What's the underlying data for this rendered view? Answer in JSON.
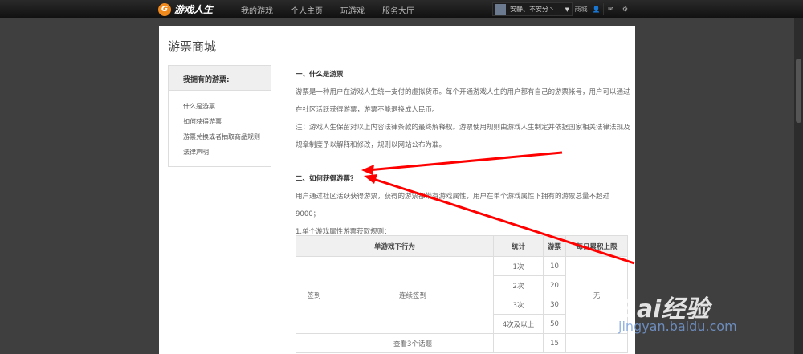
{
  "topbar": {
    "logo": "游戏人生",
    "nav": [
      "我的游戏",
      "个人主页",
      "玩游戏",
      "服务大厅"
    ],
    "username": "安静、不安分丶",
    "mall": "商城"
  },
  "page": {
    "title": "游票商城",
    "sidebar": {
      "header": "我拥有的游票:",
      "items": [
        "什么是游票",
        "如何获得游票",
        "游票兑换或者抽取商品规则",
        "法律声明"
      ]
    },
    "s1": {
      "heading": "一、什么是游票",
      "p1": "游票是一种用户在游戏人生统一支付的虚拟货币。每个开通游戏人生的用户都有自己的游票帐号，用户可以通过在社区活跃获得游票，游票不能退换成人民币。",
      "p2": "注：游戏人生保留对以上内容法律条款的最终解释权。游票使用规则由游戏人生制定并依据国家相关法律法规及规章制度予以解释和修改，规则以网站公布为准。"
    },
    "s2": {
      "heading": "二、如何获得游票？",
      "p1": "用户通过社区活跃获得游票，获得的游票都带有游戏属性，用户在单个游戏属性下拥有的游票总量不超过9000；",
      "p2": "1.单个游戏属性游票获取规则："
    },
    "table": {
      "headers": [
        "单游戏下行为",
        "统计",
        "游票",
        "每日累积上限"
      ],
      "rows": [
        {
          "cat": "签到",
          "action": "连续签到",
          "stats": [
            "1次",
            "2次",
            "3次",
            "4次及以上"
          ],
          "tickets": [
            "10",
            "20",
            "30",
            "50"
          ],
          "limit": "无"
        },
        {
          "action": "查看3个话题",
          "tickets": "15"
        }
      ]
    }
  },
  "watermark": {
    "brand": "Bai经验",
    "url": "jingyan.baidu.com"
  }
}
